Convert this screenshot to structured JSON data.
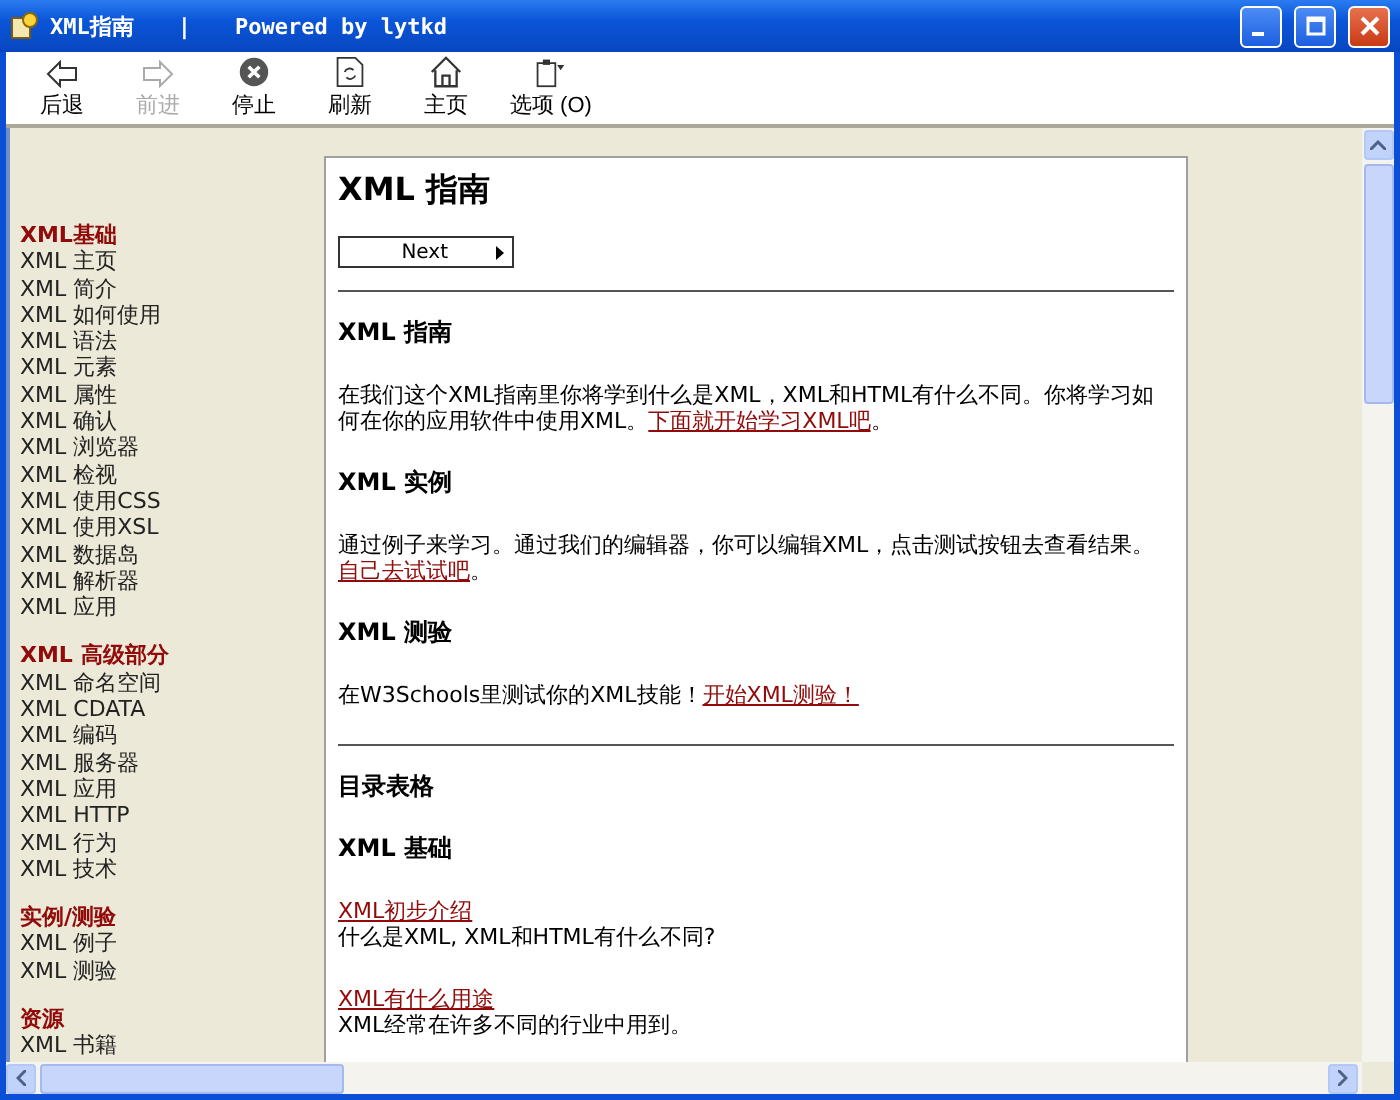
{
  "window": {
    "title": "XML指南",
    "separator": "|",
    "subtitle": "Powered by lytkd"
  },
  "toolbar": [
    {
      "label": "后退",
      "kind": "back",
      "disabled": false
    },
    {
      "label": "前进",
      "kind": "forward",
      "disabled": true
    },
    {
      "label": "停止",
      "kind": "stop",
      "disabled": false
    },
    {
      "label": "刷新",
      "kind": "refresh",
      "disabled": false
    },
    {
      "label": "主页",
      "kind": "home",
      "disabled": false
    },
    {
      "label": "选项 (O)",
      "kind": "options",
      "disabled": false
    }
  ],
  "sidebar": {
    "sections": [
      {
        "heading": "XML基础",
        "items": [
          "XML 主页",
          "XML 简介",
          "XML 如何使用",
          "XML 语法",
          "XML 元素",
          "XML 属性",
          "XML 确认",
          "XML 浏览器",
          "XML 检视",
          "XML 使用CSS",
          "XML 使用XSL",
          "XML 数据岛",
          "XML 解析器",
          "XML 应用"
        ]
      },
      {
        "heading": "XML 高级部分",
        "items": [
          "XML 命名空间",
          "XML CDATA",
          "XML 编码",
          "XML 服务器",
          "XML 应用",
          "XML HTTP",
          "XML 行为",
          "XML 技术"
        ]
      },
      {
        "heading": "实例/测验",
        "items": [
          "XML 例子",
          "XML 测验"
        ]
      },
      {
        "heading": "资源",
        "items": [
          "XML 书籍"
        ]
      }
    ]
  },
  "page": {
    "title": "XML 指南",
    "next_button": "Next",
    "blocks": [
      {
        "kind": "rule"
      },
      {
        "kind": "heading",
        "text": "XML 指南"
      },
      {
        "kind": "paragraph",
        "parts": [
          {
            "text": "在我们这个XML指南里你将学到什么是XML，XML和HTML有什么不同。你将学习如何在你的应用软件中使用XML。",
            "link": false
          },
          {
            "text": "下面就开始学习XML吧",
            "link": true
          },
          {
            "text": "。",
            "link": false
          }
        ]
      },
      {
        "kind": "heading",
        "text": "XML 实例"
      },
      {
        "kind": "paragraph",
        "parts": [
          {
            "text": "通过例子来学习。通过我们的编辑器，你可以编辑XML，点击测试按钮去查看结果。",
            "link": false
          },
          {
            "text": "自己去试试吧",
            "link": true
          },
          {
            "text": "。",
            "link": false
          }
        ]
      },
      {
        "kind": "heading",
        "text": "XML 测验"
      },
      {
        "kind": "paragraph",
        "parts": [
          {
            "text": "在W3Schools里测试你的XML技能！",
            "link": false
          },
          {
            "text": "开始XML测验！",
            "link": true
          }
        ]
      },
      {
        "kind": "rule"
      },
      {
        "kind": "heading",
        "text": "目录表格"
      },
      {
        "kind": "heading",
        "text": "XML 基础"
      },
      {
        "kind": "entry",
        "link": "XML初步介绍",
        "description": "什么是XML, XML和HTML有什么不同?"
      },
      {
        "kind": "entry",
        "link": "XML有什么用途",
        "description": "XML经常在许多不同的行业中用到。"
      }
    ]
  }
}
